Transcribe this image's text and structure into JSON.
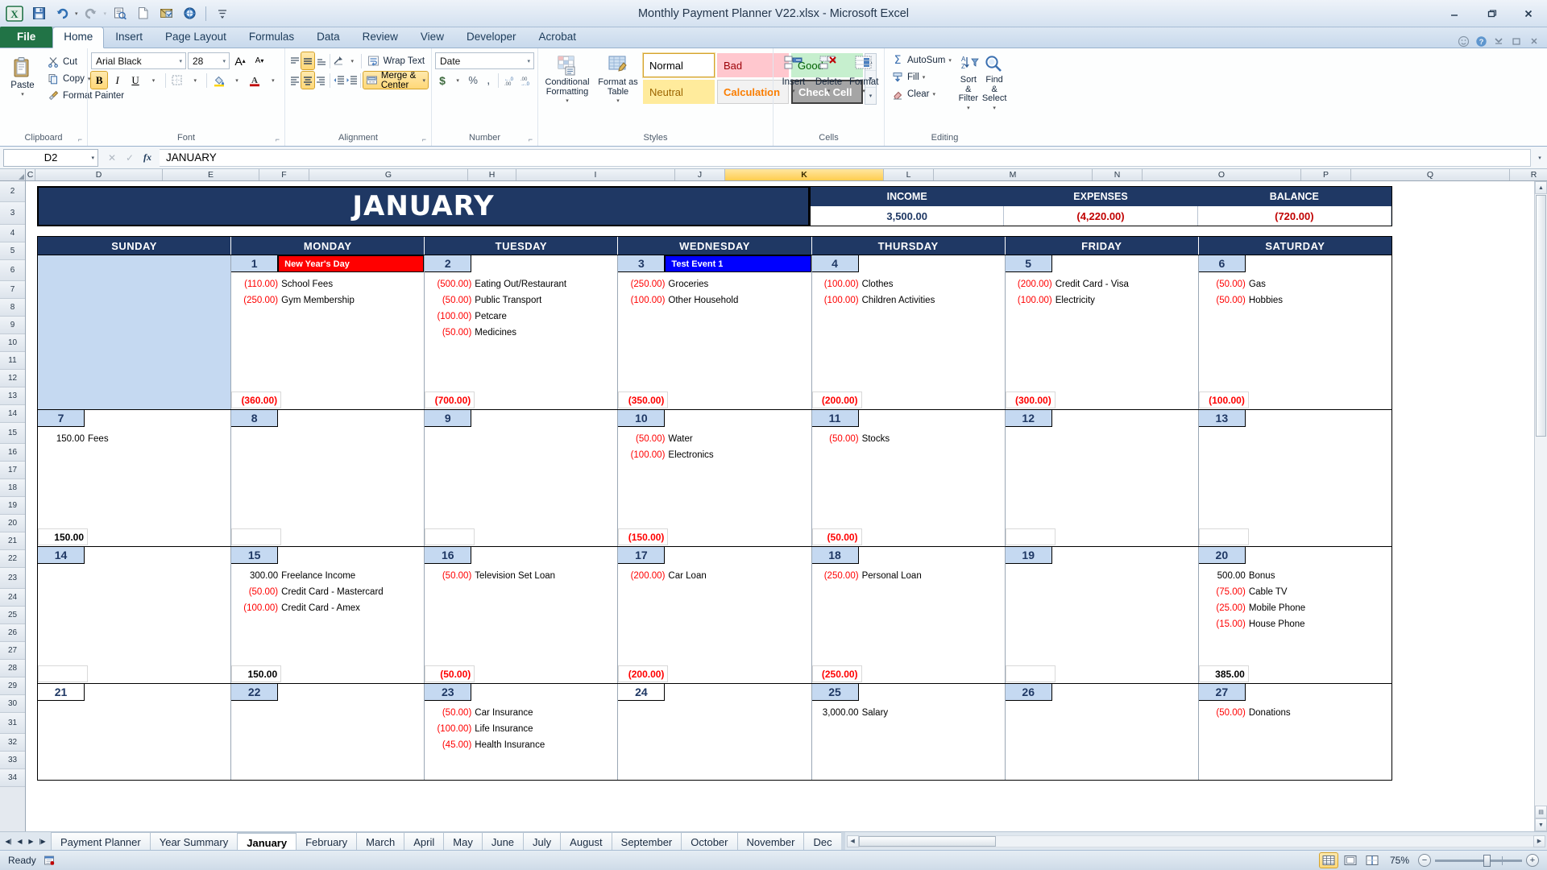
{
  "window": {
    "title": "Monthly Payment Planner V22.xlsx  -  Microsoft Excel",
    "minimize": "–",
    "restore": "❐",
    "close": "✕"
  },
  "quick_access": [
    "save-icon",
    "undo-icon",
    "redo-icon",
    "print-preview-icon",
    "new-icon",
    "email-icon",
    "open-icon",
    "customize-qat-icon"
  ],
  "ribbon": {
    "tabs": [
      {
        "label": "File",
        "active": false,
        "file": true
      },
      {
        "label": "Home",
        "active": true
      },
      {
        "label": "Insert",
        "active": false
      },
      {
        "label": "Page Layout",
        "active": false
      },
      {
        "label": "Formulas",
        "active": false
      },
      {
        "label": "Data",
        "active": false
      },
      {
        "label": "Review",
        "active": false
      },
      {
        "label": "View",
        "active": false
      },
      {
        "label": "Developer",
        "active": false
      },
      {
        "label": "Acrobat",
        "active": false
      }
    ],
    "groups": {
      "clipboard": {
        "label": "Clipboard",
        "paste": "Paste",
        "cut": "Cut",
        "copy": "Copy",
        "format_painter": "Format Painter"
      },
      "font": {
        "label": "Font",
        "font_name": "Arial Black",
        "font_size": "28",
        "grow": "A",
        "shrink": "A",
        "bold": "B",
        "italic": "I",
        "underline": "U",
        "borders": "borders",
        "fill_color": "fill-color",
        "font_color": "font-color"
      },
      "alignment": {
        "label": "Alignment",
        "wrap_text": "Wrap Text",
        "merge_center": "Merge & Center"
      },
      "number": {
        "label": "Number",
        "format": "Date",
        "currency": "$",
        "percent": "%",
        "comma": ",",
        "inc_decimal": "inc-decimal",
        "dec_decimal": "dec-decimal"
      },
      "styles": {
        "label": "Styles",
        "conditional_formatting": "Conditional Formatting",
        "format_as_table": "Format as Table",
        "cell_styles": [
          "Normal",
          "Bad",
          "Good",
          "Neutral",
          "Calculation",
          "Check Cell"
        ]
      },
      "cells": {
        "label": "Cells",
        "insert": "Insert",
        "delete": "Delete",
        "format": "Format"
      },
      "editing": {
        "label": "Editing",
        "autosum": "AutoSum",
        "fill": "Fill",
        "clear": "Clear",
        "sort_filter": "Sort & Filter",
        "find_select": "Find & Select"
      }
    }
  },
  "formula_bar": {
    "name_box": "D2",
    "value": "JANUARY"
  },
  "grid": {
    "columns": [
      "C",
      "D",
      "E",
      "F",
      "G",
      "H",
      "I",
      "J",
      "K",
      "L",
      "M",
      "N",
      "O",
      "P",
      "Q",
      "R"
    ],
    "selected_column": "K",
    "rows": [
      "2",
      "3",
      "4",
      "5",
      "6",
      "7",
      "8",
      "9",
      "10",
      "11",
      "12",
      "13",
      "14",
      "15",
      "16",
      "17",
      "18",
      "19",
      "20",
      "21",
      "22",
      "23",
      "24",
      "25",
      "26",
      "27",
      "28",
      "29",
      "30",
      "31",
      "32",
      "33",
      "34"
    ]
  },
  "calendar": {
    "month": "JANUARY",
    "summary": {
      "headers": [
        "INCOME",
        "EXPENSES",
        "BALANCE"
      ],
      "values": [
        "3,500.00",
        "(4,220.00)",
        "(720.00)"
      ],
      "value_types": [
        "pos",
        "neg",
        "neg"
      ]
    },
    "day_names": [
      "SUNDAY",
      "MONDAY",
      "TUESDAY",
      "WEDNESDAY",
      "THURSDAY",
      "FRIDAY",
      "SATURDAY"
    ],
    "weeks": [
      [
        {
          "empty": true
        },
        {
          "day": "1",
          "shaded": true,
          "event": {
            "text": "New Year's Day",
            "color": "red"
          },
          "items": [
            {
              "amount": "(110.00)",
              "type": "neg",
              "desc": "School Fees"
            },
            {
              "amount": "(250.00)",
              "type": "neg",
              "desc": "Gym Membership"
            }
          ],
          "total": "(360.00)",
          "total_type": "neg"
        },
        {
          "day": "2",
          "shaded": true,
          "event": null,
          "items": [
            {
              "amount": "(500.00)",
              "type": "neg",
              "desc": "Eating Out/Restaurant"
            },
            {
              "amount": "(50.00)",
              "type": "neg",
              "desc": "Public Transport"
            },
            {
              "amount": "(100.00)",
              "type": "neg",
              "desc": "Petcare"
            },
            {
              "amount": "(50.00)",
              "type": "neg",
              "desc": "Medicines"
            }
          ],
          "total": "(700.00)",
          "total_type": "neg"
        },
        {
          "day": "3",
          "shaded": true,
          "event": {
            "text": "Test Event 1",
            "color": "blue"
          },
          "items": [
            {
              "amount": "(250.00)",
              "type": "neg",
              "desc": "Groceries"
            },
            {
              "amount": "(100.00)",
              "type": "neg",
              "desc": "Other Household"
            }
          ],
          "total": "(350.00)",
          "total_type": "neg"
        },
        {
          "day": "4",
          "shaded": true,
          "event": null,
          "items": [
            {
              "amount": "(100.00)",
              "type": "neg",
              "desc": "Clothes"
            },
            {
              "amount": "(100.00)",
              "type": "neg",
              "desc": "Children Activities"
            }
          ],
          "total": "(200.00)",
          "total_type": "neg"
        },
        {
          "day": "5",
          "shaded": true,
          "event": null,
          "items": [
            {
              "amount": "(200.00)",
              "type": "neg",
              "desc": "Credit Card - Visa"
            },
            {
              "amount": "(100.00)",
              "type": "neg",
              "desc": "Electricity"
            }
          ],
          "total": "(300.00)",
          "total_type": "neg"
        },
        {
          "day": "6",
          "shaded": true,
          "event": null,
          "items": [
            {
              "amount": "(50.00)",
              "type": "neg",
              "desc": "Gas"
            },
            {
              "amount": "(50.00)",
              "type": "neg",
              "desc": "Hobbies"
            }
          ],
          "total": "(100.00)",
          "total_type": "neg"
        }
      ],
      [
        {
          "day": "7",
          "shaded": true,
          "event": null,
          "items": [
            {
              "amount": "150.00",
              "type": "pos",
              "desc": "Fees"
            }
          ],
          "total": "150.00",
          "total_type": "pos"
        },
        {
          "day": "8",
          "shaded": true,
          "event": null,
          "items": [],
          "total": "",
          "total_type": "blank"
        },
        {
          "day": "9",
          "shaded": true,
          "event": null,
          "items": [],
          "total": "",
          "total_type": "blank"
        },
        {
          "day": "10",
          "shaded": true,
          "event": null,
          "items": [
            {
              "amount": "(50.00)",
              "type": "neg",
              "desc": "Water"
            },
            {
              "amount": "(100.00)",
              "type": "neg",
              "desc": "Electronics"
            }
          ],
          "total": "(150.00)",
          "total_type": "neg"
        },
        {
          "day": "11",
          "shaded": true,
          "event": null,
          "items": [
            {
              "amount": "(50.00)",
              "type": "neg",
              "desc": "Stocks"
            }
          ],
          "total": "(50.00)",
          "total_type": "neg"
        },
        {
          "day": "12",
          "shaded": true,
          "event": null,
          "items": [],
          "total": "",
          "total_type": "blank"
        },
        {
          "day": "13",
          "shaded": true,
          "event": null,
          "items": [],
          "total": "",
          "total_type": "blank"
        }
      ],
      [
        {
          "day": "14",
          "shaded": true,
          "event": null,
          "items": [],
          "total": "",
          "total_type": "blank"
        },
        {
          "day": "15",
          "shaded": true,
          "event": null,
          "items": [
            {
              "amount": "300.00",
              "type": "pos",
              "desc": "Freelance Income"
            },
            {
              "amount": "(50.00)",
              "type": "neg",
              "desc": "Credit Card - Mastercard"
            },
            {
              "amount": "(100.00)",
              "type": "neg",
              "desc": "Credit Card - Amex"
            }
          ],
          "total": "150.00",
          "total_type": "pos"
        },
        {
          "day": "16",
          "shaded": true,
          "event": null,
          "items": [
            {
              "amount": "(50.00)",
              "type": "neg",
              "desc": "Television Set Loan"
            }
          ],
          "total": "(50.00)",
          "total_type": "neg"
        },
        {
          "day": "17",
          "shaded": true,
          "event": null,
          "items": [
            {
              "amount": "(200.00)",
              "type": "neg",
              "desc": "Car Loan"
            }
          ],
          "total": "(200.00)",
          "total_type": "neg"
        },
        {
          "day": "18",
          "shaded": true,
          "event": null,
          "items": [
            {
              "amount": "(250.00)",
              "type": "neg",
              "desc": "Personal Loan"
            }
          ],
          "total": "(250.00)",
          "total_type": "neg"
        },
        {
          "day": "19",
          "shaded": true,
          "event": null,
          "items": [],
          "total": "",
          "total_type": "blank"
        },
        {
          "day": "20",
          "shaded": true,
          "event": null,
          "items": [
            {
              "amount": "500.00",
              "type": "pos",
              "desc": "Bonus"
            },
            {
              "amount": "(75.00)",
              "type": "neg",
              "desc": "Cable TV"
            },
            {
              "amount": "(25.00)",
              "type": "neg",
              "desc": "Mobile Phone"
            },
            {
              "amount": "(15.00)",
              "type": "neg",
              "desc": "House Phone"
            }
          ],
          "total": "385.00",
          "total_type": "pos"
        }
      ],
      [
        {
          "day": "21",
          "shaded": false,
          "event": null,
          "items": [],
          "total": "",
          "total_type": "blank"
        },
        {
          "day": "22",
          "shaded": true,
          "event": null,
          "items": [],
          "total": "",
          "total_type": "blank"
        },
        {
          "day": "23",
          "shaded": true,
          "event": null,
          "items": [
            {
              "amount": "(50.00)",
              "type": "neg",
              "desc": "Car Insurance"
            },
            {
              "amount": "(100.00)",
              "type": "neg",
              "desc": "Life Insurance"
            },
            {
              "amount": "(45.00)",
              "type": "neg",
              "desc": "Health Insurance"
            }
          ],
          "total": "",
          "total_type": "blank"
        },
        {
          "day": "24",
          "shaded": false,
          "event": null,
          "items": [],
          "total": "",
          "total_type": "blank"
        },
        {
          "day": "25",
          "shaded": true,
          "event": null,
          "items": [
            {
              "amount": "3,000.00",
              "type": "pos",
              "desc": "Salary"
            }
          ],
          "total": "",
          "total_type": "blank"
        },
        {
          "day": "26",
          "shaded": true,
          "event": null,
          "items": [],
          "total": "",
          "total_type": "blank"
        },
        {
          "day": "27",
          "shaded": true,
          "event": null,
          "items": [
            {
              "amount": "(50.00)",
              "type": "neg",
              "desc": "Donations"
            }
          ],
          "total": "",
          "total_type": "blank"
        }
      ]
    ]
  },
  "sheet_tabs": {
    "items": [
      "Payment Planner",
      "Year Summary",
      "January",
      "February",
      "March",
      "April",
      "May",
      "June",
      "July",
      "August",
      "September",
      "October",
      "November",
      "Dec"
    ],
    "active": "January"
  },
  "status_bar": {
    "state": "Ready",
    "zoom": "75%",
    "views": [
      "normal-view",
      "page-layout-view",
      "page-break-view"
    ]
  },
  "colors": {
    "header_navy": "#1f3864",
    "date_blue": "#c5d9f1",
    "negative_red": "#ff0000",
    "event_red": "#ff0000",
    "event_blue": "#0000ff",
    "excel_green": "#217346"
  }
}
